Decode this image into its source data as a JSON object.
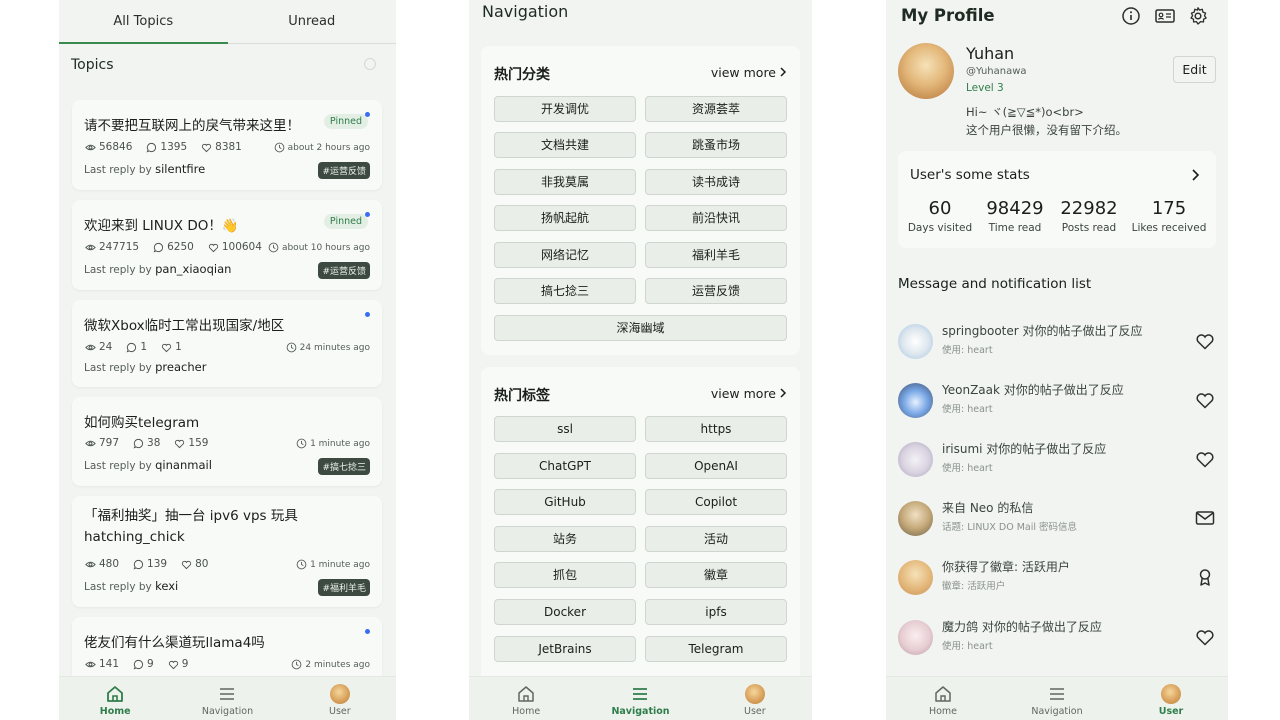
{
  "screen1": {
    "tabs": [
      "All Topics",
      "Unread"
    ],
    "topics_title": "Topics",
    "topics": [
      {
        "title": "请不要把互联网上的戾气带来这里！",
        "pinned": "Pinned",
        "views": "56846",
        "replies": "1395",
        "likes": "8381",
        "time": "about 2 hours ago",
        "last_reply_prefix": "Last reply by",
        "last_reply_user": "silentfire",
        "category": "#运营反馈"
      },
      {
        "title": "欢迎来到 LINUX DO！👋",
        "pinned": "Pinned",
        "views": "247715",
        "replies": "6250",
        "likes": "100604",
        "time": "about 10 hours ago",
        "last_reply_prefix": "Last reply by",
        "last_reply_user": "pan_xiaoqian",
        "category": "#运营反馈"
      },
      {
        "title": "微软Xbox临时工常出现国家/地区",
        "pinned": "",
        "views": "24",
        "replies": "1",
        "likes": "1",
        "time": "24 minutes ago",
        "last_reply_prefix": "Last reply by",
        "last_reply_user": "preacher",
        "category": ""
      },
      {
        "title": "如何购买telegram",
        "pinned": "",
        "views": "797",
        "replies": "38",
        "likes": "159",
        "time": "1 minute ago",
        "last_reply_prefix": "Last reply by",
        "last_reply_user": "qinanmail",
        "category": "#搞七捻三"
      },
      {
        "title": "「福利抽奖」抽一台 ipv6 vps 玩具 hatching_chick",
        "pinned": "",
        "views": "480",
        "replies": "139",
        "likes": "80",
        "time": "1 minute ago",
        "last_reply_prefix": "Last reply by",
        "last_reply_user": "kexi",
        "category": "#福利羊毛"
      },
      {
        "title": "佬友们有什么渠道玩llama4吗",
        "pinned": "",
        "views": "141",
        "replies": "9",
        "likes": "9",
        "time": "2 minutes ago",
        "last_reply_prefix": "",
        "last_reply_user": "",
        "category": ""
      }
    ],
    "nav": {
      "home": "Home",
      "navigation": "Navigation",
      "user": "User"
    }
  },
  "screen2": {
    "title": "Navigation",
    "categories": {
      "heading": "热门分类",
      "view_more": "view more",
      "items": [
        "开发调优",
        "资源荟萃",
        "文档共建",
        "跳蚤市场",
        "非我莫属",
        "读书成诗",
        "扬帆起航",
        "前沿快讯",
        "网络记忆",
        "福利羊毛",
        "搞七捻三",
        "运营反馈",
        "深海幽域"
      ]
    },
    "tags": {
      "heading": "热门标签",
      "view_more": "view more",
      "items": [
        "ssl",
        "https",
        "ChatGPT",
        "OpenAI",
        "GitHub",
        "Copilot",
        "站务",
        "活动",
        "抓包",
        "徽章",
        "Docker",
        "ipfs",
        "JetBrains",
        "Telegram"
      ]
    },
    "nav": {
      "home": "Home",
      "navigation": "Navigation",
      "user": "User"
    }
  },
  "screen3": {
    "title": "My Profile",
    "name": "Yuhan",
    "handle": "@Yuhanawa",
    "level": "Level 3",
    "edit": "Edit",
    "bio_line1": "Hi~ ヾ(≧▽≦*)o<br>",
    "bio_line2": "这个用户很懒，没有留下介绍。",
    "stats_title": "User's some stats",
    "stats": [
      {
        "value": "60",
        "label": "Days visited"
      },
      {
        "value": "98429",
        "label": "Time read"
      },
      {
        "value": "22982",
        "label": "Posts read"
      },
      {
        "value": "175",
        "label": "Likes received"
      }
    ],
    "messages_title": "Message and notification list",
    "messages": [
      {
        "title": "springbooter 对你的帖子做出了反应",
        "sub": "使用: heart",
        "icon": "heart-icon"
      },
      {
        "title": "YeonZaak 对你的帖子做出了反应",
        "sub": "使用: heart",
        "icon": "heart-icon"
      },
      {
        "title": "irisumi 对你的帖子做出了反应",
        "sub": "使用: heart",
        "icon": "heart-icon"
      },
      {
        "title": "来自 Neo 的私信",
        "sub": "话题: LINUX DO Mail 密码信息",
        "icon": "mail-icon"
      },
      {
        "title": "你获得了徽章: 活跃用户",
        "sub": "徽章: 活跃用户",
        "icon": "badge-icon"
      },
      {
        "title": "魔力鸽 对你的帖子做出了反应",
        "sub": "使用: heart",
        "icon": "heart-icon"
      }
    ],
    "nav": {
      "home": "Home",
      "navigation": "Navigation",
      "user": "User"
    }
  },
  "colors": {
    "accent": "#2e7d4a",
    "background": "#f1f4f0",
    "card": "#f8faf7",
    "unread_dot": "#3a6ef0"
  }
}
